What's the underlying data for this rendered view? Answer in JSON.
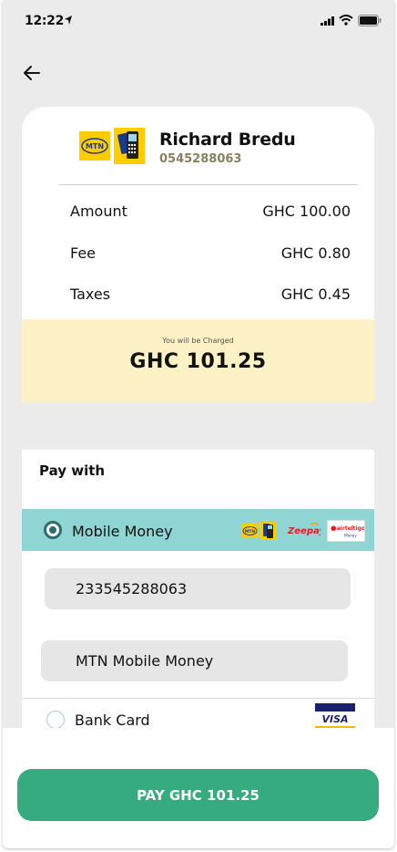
{
  "status_bar": {
    "time": "12:22"
  },
  "payee": {
    "name": "Richard Bredu",
    "phone": "0545288063",
    "logo_text": "MTN"
  },
  "breakdown": [
    {
      "label": "Amount",
      "value": "GHC 100.00"
    },
    {
      "label": "Fee",
      "value": "GHC 0.80"
    },
    {
      "label": "Taxes",
      "value": "GHC 0.45"
    }
  ],
  "charge": {
    "caption": "You will be Charged",
    "total": "GHC 101.25"
  },
  "pay_with": {
    "title": "Pay with",
    "options": [
      {
        "label": "Mobile Money",
        "selected": true,
        "logos": [
          "MTN",
          "Zeepay",
          "airteltigo Money"
        ]
      },
      {
        "label": "Bank Card",
        "selected": false,
        "logos": [
          "VISA"
        ]
      }
    ],
    "phone_number": "233545288063",
    "network": "MTN Mobile Money"
  },
  "pay_button": {
    "label": "PAY GHC 101.25"
  },
  "colors": {
    "accent": "#35ab7f",
    "selected_option_bg": "#8fd5d4",
    "charge_bg": "#fdf1c6",
    "mtn_yellow": "#ffcc00"
  },
  "icons": [
    "location-arrow-icon",
    "signal-icon",
    "wifi-icon",
    "battery-icon",
    "back-arrow-icon",
    "radio-selected-icon",
    "radio-unselected-icon"
  ]
}
